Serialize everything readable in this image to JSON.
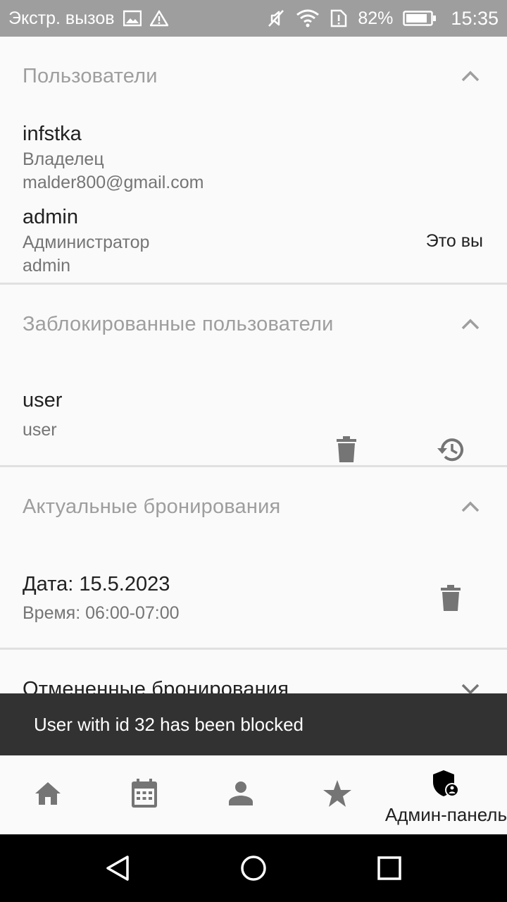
{
  "status_bar": {
    "carrier": "Экстр. вызов",
    "battery": "82%",
    "time": "15:35"
  },
  "users_section": {
    "title": "Пользователи",
    "users": [
      {
        "name": "infstka",
        "role": "Владелец",
        "email": "malder800@gmail.com"
      },
      {
        "name": "admin",
        "role": "Администратор",
        "email": "admin",
        "note": "Это вы"
      }
    ]
  },
  "blocked_section": {
    "title": "Заблокированные пользователи",
    "users": [
      {
        "name": "user",
        "email": "user"
      }
    ]
  },
  "bookings_section": {
    "title": "Актуальные бронирования",
    "items": [
      {
        "date": "Дата: 15.5.2023",
        "time": "Время: 06:00-07:00"
      }
    ]
  },
  "cancelled_section": {
    "title": "Отмененные бронирования"
  },
  "snackbar": {
    "message": "User with id 32 has been blocked"
  },
  "bottom_nav": {
    "active_label": "Админ-панель"
  }
}
